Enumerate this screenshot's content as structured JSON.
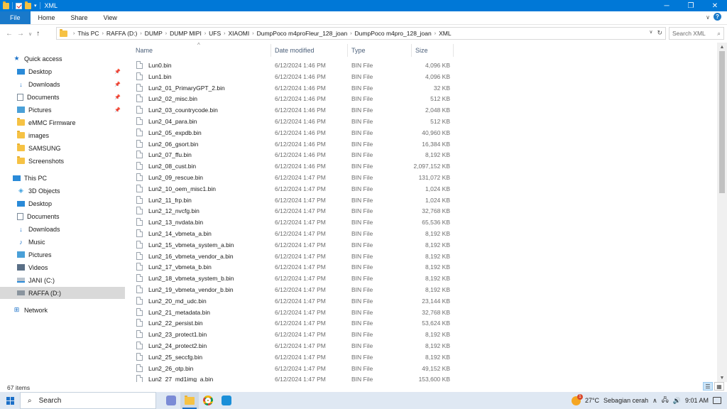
{
  "window": {
    "title": "XML",
    "controls": [
      "─",
      "❐",
      "✕"
    ]
  },
  "ribbon": {
    "tabs": [
      "File",
      "Home",
      "Share",
      "View"
    ]
  },
  "address": {
    "crumbs": [
      "This PC",
      "RAFFA (D:)",
      "DUMP",
      "DUMP MIPI",
      "UFS",
      "XIAOMI",
      "DumpPoco m4proFleur_128_joan",
      "DumpPoco m4pro_128_joan",
      "XML"
    ],
    "search_placeholder": "Search XML"
  },
  "nav": {
    "quick_access": "Quick access",
    "quick_items": [
      "Desktop",
      "Downloads",
      "Documents",
      "Pictures",
      "eMMC Firmware",
      "images",
      "SAMSUNG",
      "Screenshots"
    ],
    "this_pc": "This PC",
    "pc_items": [
      "3D Objects",
      "Desktop",
      "Documents",
      "Downloads",
      "Music",
      "Pictures",
      "Videos",
      "JANI (C:)",
      "RAFFA (D:)"
    ],
    "network": "Network"
  },
  "columns": {
    "name": "Name",
    "date": "Date modified",
    "type": "Type",
    "size": "Size"
  },
  "files": [
    {
      "name": "Lun0.bin",
      "date": "6/12/2024 1:46 PM",
      "type": "BIN File",
      "size": "4,096 KB"
    },
    {
      "name": "Lun1.bin",
      "date": "6/12/2024 1:46 PM",
      "type": "BIN File",
      "size": "4,096 KB"
    },
    {
      "name": "Lun2_01_PrimaryGPT_2.bin",
      "date": "6/12/2024 1:46 PM",
      "type": "BIN File",
      "size": "32 KB"
    },
    {
      "name": "Lun2_02_misc.bin",
      "date": "6/12/2024 1:46 PM",
      "type": "BIN File",
      "size": "512 KB"
    },
    {
      "name": "Lun2_03_countrycode.bin",
      "date": "6/12/2024 1:46 PM",
      "type": "BIN File",
      "size": "2,048 KB"
    },
    {
      "name": "Lun2_04_para.bin",
      "date": "6/12/2024 1:46 PM",
      "type": "BIN File",
      "size": "512 KB"
    },
    {
      "name": "Lun2_05_expdb.bin",
      "date": "6/12/2024 1:46 PM",
      "type": "BIN File",
      "size": "40,960 KB"
    },
    {
      "name": "Lun2_06_gsort.bin",
      "date": "6/12/2024 1:46 PM",
      "type": "BIN File",
      "size": "16,384 KB"
    },
    {
      "name": "Lun2_07_ffu.bin",
      "date": "6/12/2024 1:46 PM",
      "type": "BIN File",
      "size": "8,192 KB"
    },
    {
      "name": "Lun2_08_cust.bin",
      "date": "6/12/2024 1:46 PM",
      "type": "BIN File",
      "size": "2,097,152 KB"
    },
    {
      "name": "Lun2_09_rescue.bin",
      "date": "6/12/2024 1:47 PM",
      "type": "BIN File",
      "size": "131,072 KB"
    },
    {
      "name": "Lun2_10_oem_misc1.bin",
      "date": "6/12/2024 1:47 PM",
      "type": "BIN File",
      "size": "1,024 KB"
    },
    {
      "name": "Lun2_11_frp.bin",
      "date": "6/12/2024 1:47 PM",
      "type": "BIN File",
      "size": "1,024 KB"
    },
    {
      "name": "Lun2_12_nvcfg.bin",
      "date": "6/12/2024 1:47 PM",
      "type": "BIN File",
      "size": "32,768 KB"
    },
    {
      "name": "Lun2_13_nvdata.bin",
      "date": "6/12/2024 1:47 PM",
      "type": "BIN File",
      "size": "65,536 KB"
    },
    {
      "name": "Lun2_14_vbmeta_a.bin",
      "date": "6/12/2024 1:47 PM",
      "type": "BIN File",
      "size": "8,192 KB"
    },
    {
      "name": "Lun2_15_vbmeta_system_a.bin",
      "date": "6/12/2024 1:47 PM",
      "type": "BIN File",
      "size": "8,192 KB"
    },
    {
      "name": "Lun2_16_vbmeta_vendor_a.bin",
      "date": "6/12/2024 1:47 PM",
      "type": "BIN File",
      "size": "8,192 KB"
    },
    {
      "name": "Lun2_17_vbmeta_b.bin",
      "date": "6/12/2024 1:47 PM",
      "type": "BIN File",
      "size": "8,192 KB"
    },
    {
      "name": "Lun2_18_vbmeta_system_b.bin",
      "date": "6/12/2024 1:47 PM",
      "type": "BIN File",
      "size": "8,192 KB"
    },
    {
      "name": "Lun2_19_vbmeta_vendor_b.bin",
      "date": "6/12/2024 1:47 PM",
      "type": "BIN File",
      "size": "8,192 KB"
    },
    {
      "name": "Lun2_20_md_udc.bin",
      "date": "6/12/2024 1:47 PM",
      "type": "BIN File",
      "size": "23,144 KB"
    },
    {
      "name": "Lun2_21_metadata.bin",
      "date": "6/12/2024 1:47 PM",
      "type": "BIN File",
      "size": "32,768 KB"
    },
    {
      "name": "Lun2_22_persist.bin",
      "date": "6/12/2024 1:47 PM",
      "type": "BIN File",
      "size": "53,624 KB"
    },
    {
      "name": "Lun2_23_protect1.bin",
      "date": "6/12/2024 1:47 PM",
      "type": "BIN File",
      "size": "8,192 KB"
    },
    {
      "name": "Lun2_24_protect2.bin",
      "date": "6/12/2024 1:47 PM",
      "type": "BIN File",
      "size": "8,192 KB"
    },
    {
      "name": "Lun2_25_seccfg.bin",
      "date": "6/12/2024 1:47 PM",
      "type": "BIN File",
      "size": "8,192 KB"
    },
    {
      "name": "Lun2_26_otp.bin",
      "date": "6/12/2024 1:47 PM",
      "type": "BIN File",
      "size": "49,152 KB"
    },
    {
      "name": "Lun2_27_md1img_a.bin",
      "date": "6/12/2024 1:47 PM",
      "type": "BIN File",
      "size": "153,600 KB"
    }
  ],
  "status": {
    "count": "67 items"
  },
  "taskbar": {
    "search_label": "Search",
    "weather_badge": "1",
    "temperature": "27°C",
    "weather_text": "Sebagian cerah",
    "time": "9:01 AM"
  },
  "colors": {
    "titlebar": "#0078d7",
    "file_tab": "#1979ca",
    "selected_nav": "#d9d9d9",
    "taskbar": "#dfe8f3"
  }
}
